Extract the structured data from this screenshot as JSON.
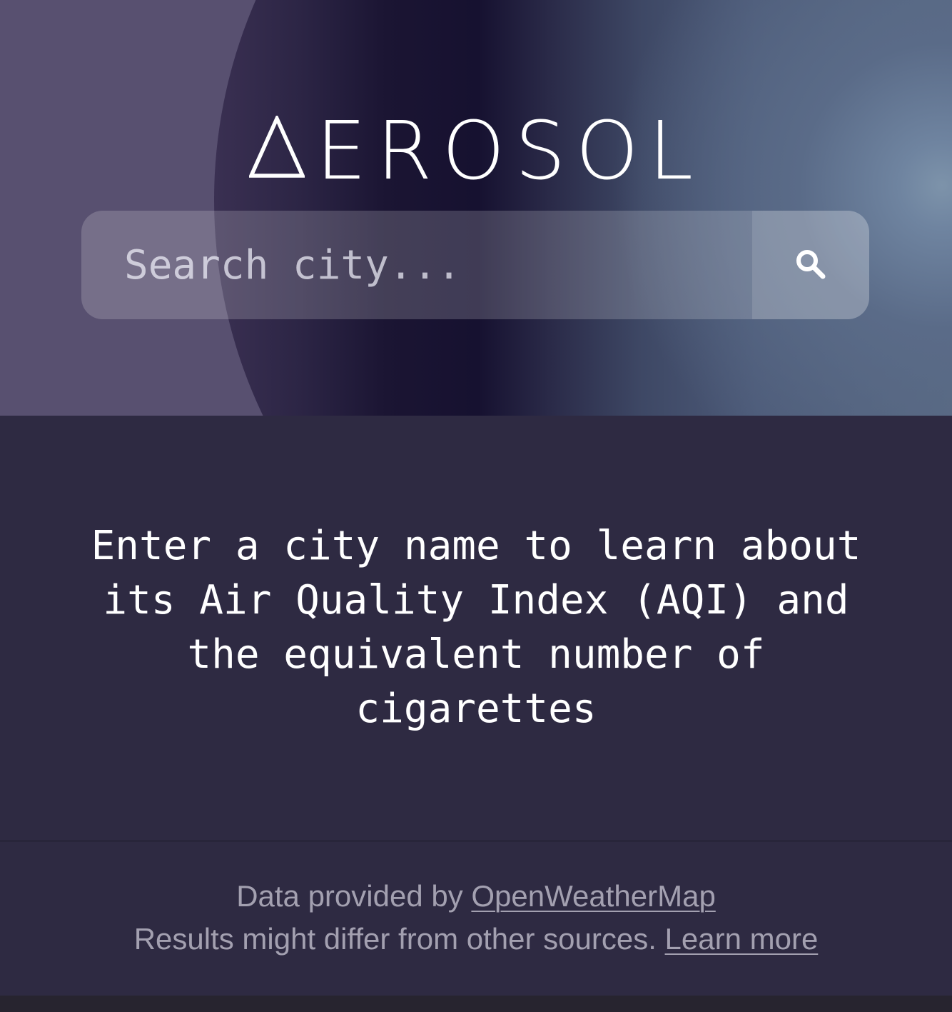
{
  "header": {
    "logo_text": "EROSOL",
    "logo_mark_icon": "delta-triangle-icon"
  },
  "search": {
    "placeholder": "Search city...",
    "value": "",
    "button_icon": "search-icon"
  },
  "main": {
    "intro_text": "Enter a city name to learn about its Air Quality Index (AQI) and the equivalent number of cigarettes"
  },
  "footer": {
    "data_prefix": "Data provided by ",
    "data_link": "OpenWeatherMap",
    "disclaimer": "Results might differ from other sources. ",
    "learn_more_link": "Learn more"
  },
  "colors": {
    "background": "#2e2a42",
    "hero_base": "#585070",
    "text_primary": "#ffffff",
    "text_muted": "#a3a0b0"
  }
}
